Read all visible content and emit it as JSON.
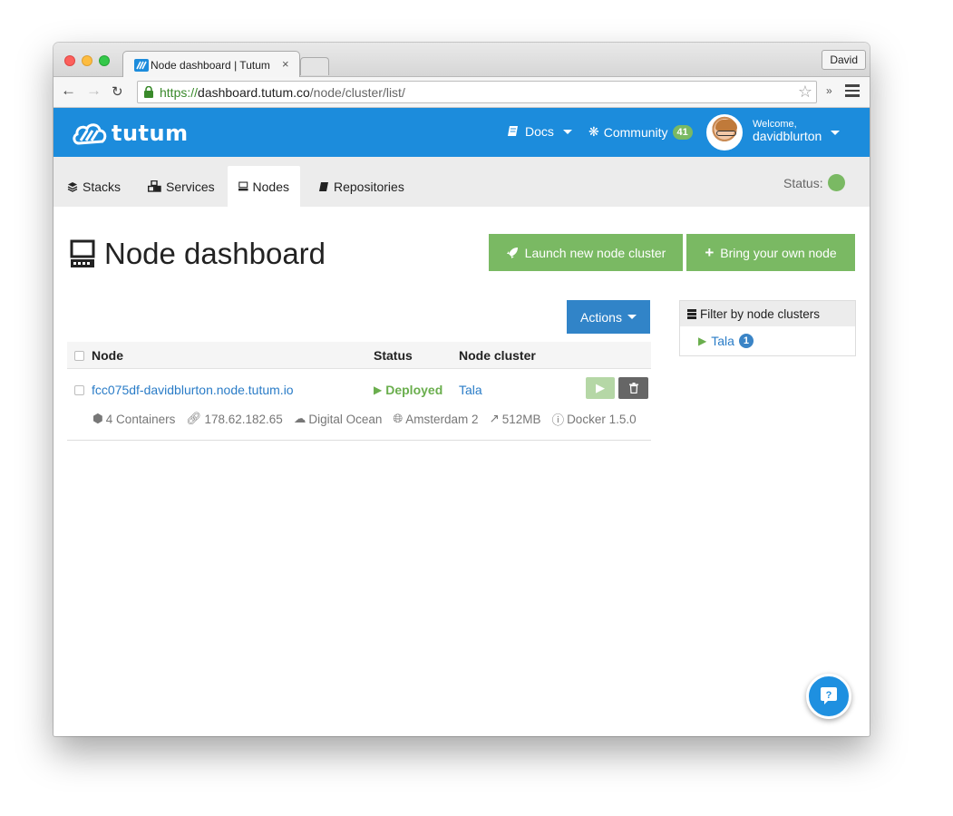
{
  "browser": {
    "tab_title": "Node dashboard | Tutum",
    "tab_close": "×",
    "profile": "David",
    "url_scheme": "https://",
    "url_host": "dashboard.tutum.co",
    "url_path": "/node/cluster/list/",
    "extensions_label": "»"
  },
  "header": {
    "logo_text": "tutum",
    "docs_label": "Docs",
    "community_label": "Community",
    "community_count": "41",
    "welcome_label": "Welcome,",
    "username": "davidblurton",
    "brand_color": "#1c8cdc"
  },
  "subnav": {
    "tabs": [
      {
        "label": "Stacks",
        "icon": "layers-icon"
      },
      {
        "label": "Services",
        "icon": "cubes-icon"
      },
      {
        "label": "Nodes",
        "icon": "node-icon",
        "active": true
      },
      {
        "label": "Repositories",
        "icon": "book-icon"
      }
    ],
    "status_label": "Status:",
    "status_color": "#7ab963"
  },
  "main": {
    "title": "Node dashboard",
    "launch_button": "Launch new node cluster",
    "byon_button": "Bring your own node",
    "actions_button": "Actions",
    "columns": {
      "node": "Node",
      "status": "Status",
      "cluster": "Node cluster"
    },
    "rows": [
      {
        "node": "fcc075df-davidblurton.node.tutum.io",
        "status": "Deployed",
        "cluster": "Tala",
        "containers": "4 Containers",
        "ip": "178.62.182.65",
        "provider": "Digital Ocean",
        "region": "Amsterdam 2",
        "memory": "512MB",
        "docker": "Docker 1.5.0"
      }
    ]
  },
  "filter": {
    "title": "Filter by node clusters",
    "items": [
      {
        "label": "Tala",
        "count": "1"
      }
    ]
  },
  "help": {
    "label": "?"
  }
}
